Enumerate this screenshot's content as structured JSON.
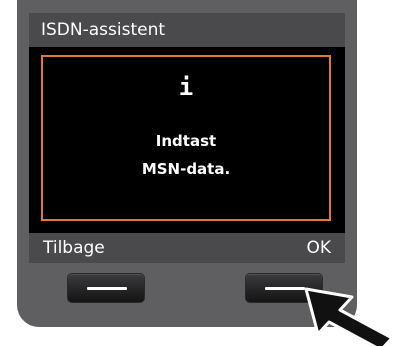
{
  "screen": {
    "title": "ISDN-assistent",
    "info_icon": "i",
    "message_line1": "Indtast",
    "message_line2": "MSN-data.",
    "info_border_color": "#e07a3a"
  },
  "softkeys": {
    "left_label": "Tilbage",
    "right_label": "OK"
  },
  "hardware_buttons": [
    {
      "name": "left-softkey-button",
      "icon": "dash-icon"
    },
    {
      "name": "right-softkey-button",
      "icon": "dash-icon",
      "highlighted_by": "pointer-arrow-icon"
    }
  ]
}
